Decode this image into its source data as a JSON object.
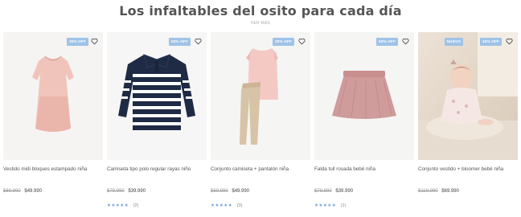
{
  "section": {
    "title": "Los infaltables del osito para cada día",
    "link_label": "VER MÁS"
  },
  "products": [
    {
      "name": "Vestido midi bloques estampado niña",
      "badge": "30% OFF",
      "price_old": "$69.990",
      "price_new": "$49.990",
      "stars": "",
      "reviews": "",
      "image_icon": "pink-dress-icon"
    },
    {
      "name": "Camiseta tipo polo regular rayas niño",
      "badge": "50% OFF",
      "price_old": "$79.990",
      "price_new": "$39.990",
      "stars": "★★★★★",
      "reviews": "(2)",
      "image_icon": "striped-polo-icon"
    },
    {
      "name": "Conjunto camiseta + pantalón niña",
      "badge": "30% OFF",
      "price_old": "$69.990",
      "price_new": "$49.990",
      "stars": "★★★★★",
      "reviews": "(3)",
      "image_icon": "top-and-pants-icon"
    },
    {
      "name": "Falda tull rosada bebé niña",
      "badge": "50% OFF",
      "price_old": "$79.990",
      "price_new": "$39.990",
      "stars": "★★★★★",
      "reviews": "(1)",
      "image_icon": "tulle-skirt-icon"
    },
    {
      "name": "Conjunto vestido + bloomer bebé niña",
      "badge_new": "NUEVO",
      "badge": "30% OFF",
      "price_old": "$119.990",
      "price_new": "$69.990",
      "stars": "",
      "reviews": "",
      "image_icon": "baby-photo-icon"
    }
  ],
  "colors": {
    "badge": "#9fc3e8",
    "stars": "#6f9fd8",
    "title": "#555555",
    "image_bg": "#f4f3f1"
  }
}
